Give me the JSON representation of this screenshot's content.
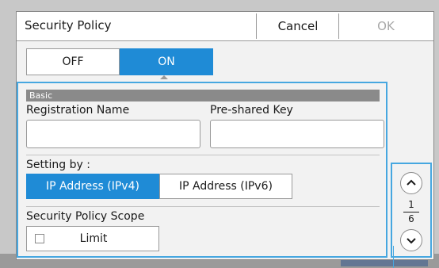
{
  "dialog": {
    "title": "Security Policy",
    "cancel_label": "Cancel",
    "ok_label": "OK"
  },
  "toggle": {
    "off_label": "OFF",
    "on_label": "ON",
    "selected": "ON"
  },
  "basic": {
    "section_title": "Basic",
    "registration_name_label": "Registration Name",
    "registration_name_value": "",
    "preshared_key_label": "Pre-shared Key",
    "preshared_key_value": ""
  },
  "setting_by": {
    "label": "Setting by :",
    "options": [
      "IP Address (IPv4)",
      "IP Address (IPv6)"
    ],
    "selected": "IP Address (IPv4)"
  },
  "scope": {
    "label": "Security Policy Scope",
    "limit_label": "Limit",
    "limit_checked": false
  },
  "pager": {
    "current": "1",
    "total": "6",
    "up_icon": "chevron-up-icon",
    "down_icon": "chevron-down-icon"
  },
  "colors": {
    "accent": "#1f8bd6",
    "focus_border": "#46a7e0",
    "section_bar": "#8a8a8a",
    "disabled_text": "#a8a8a8"
  }
}
